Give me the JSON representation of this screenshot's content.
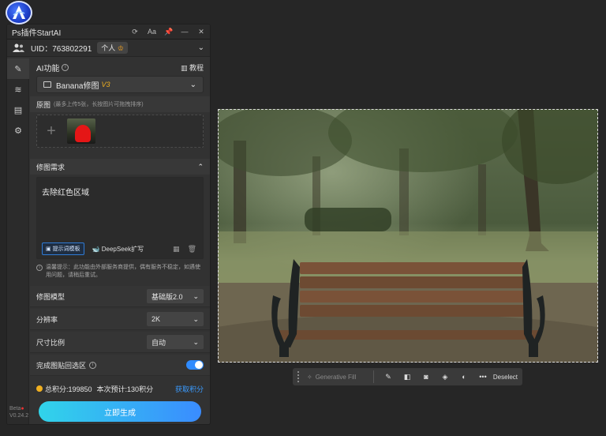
{
  "panel": {
    "title": "Ps插件StartAI",
    "uid_label": "UID：763802291",
    "account_badge": "个人",
    "version": [
      "Beta",
      "V0.24.2"
    ]
  },
  "ai": {
    "section_label": "AI功能",
    "tutorial_label": "教程",
    "selected_function": "Banana修图",
    "function_version": "V3"
  },
  "source": {
    "label": "原图",
    "hint": "(最多上传5张，长按图片可拖拽排序)"
  },
  "requirement": {
    "label": "修图需求",
    "text": "去除红色区域",
    "template_button": "提示词模板",
    "deepseek_button": "DeepSeek扩写",
    "notice": "温馨提示：此功能由外部服务商提供，偶有服务不稳定，如遇使用问题，请稍后重试。"
  },
  "options": {
    "model_label": "修图模型",
    "model_value": "基础版2.0",
    "resolution_label": "分辨率",
    "resolution_value": "2K",
    "ratio_label": "尺寸比例",
    "ratio_value": "自动",
    "paste_back_label": "完成图贴回选区",
    "paste_back_on": true
  },
  "points": {
    "total": "总积分:199850",
    "estimate": "本次预计:130积分",
    "get_link": "获取积分"
  },
  "generate_button": "立即生成",
  "taskbar": {
    "generative_fill": "Generative Fill",
    "deselect": "Deselect"
  },
  "colors": {
    "accent_blue": "#2f8bff",
    "gradient_start": "#31d4ea",
    "gradient_end": "#3a8cff",
    "highlight_yellow": "#f0b020",
    "mask_red": "#e51616"
  }
}
